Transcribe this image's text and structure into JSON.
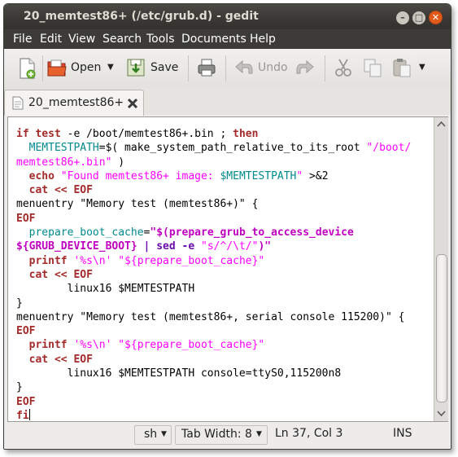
{
  "window": {
    "title": "20_memtest86+ (/etc/grub.d) - gedit",
    "buttons": {
      "minimize": "–",
      "maximize": "□",
      "close": "✕"
    }
  },
  "menu": [
    "File",
    "Edit",
    "View",
    "Search",
    "Tools",
    "Documents",
    "Help"
  ],
  "toolbar": {
    "open_label": "Open",
    "save_label": "Save",
    "undo_label": "Undo",
    "icons": [
      "new-document-icon",
      "open-folder-icon",
      "save-icon",
      "print-icon",
      "undo-icon",
      "redo-icon",
      "cut-icon",
      "copy-icon",
      "paste-icon"
    ]
  },
  "tab": {
    "label": "20_memtest86+"
  },
  "code_lines": [
    [
      [
        "kw",
        "if test"
      ],
      [
        "plain",
        " -e /boot/memtest86+.bin ; "
      ],
      [
        "kw",
        "then"
      ]
    ],
    [
      [
        "var",
        "  MEMTESTPATH"
      ],
      [
        "plain",
        "=$( make_system_path_relative_to_its_root "
      ],
      [
        "str",
        "\"/boot/"
      ]
    ],
    [
      [
        "str",
        "memtest86+.bin\""
      ],
      [
        "plain",
        " )"
      ]
    ],
    [
      [
        "kw",
        "  echo"
      ],
      [
        "str",
        " \"Found memtest86+ image: "
      ],
      [
        "var",
        "$MEMTESTPATH"
      ],
      [
        "str",
        "\""
      ],
      [
        "plain",
        " >&2"
      ]
    ],
    [
      [
        "kw",
        "  cat << EOF"
      ]
    ],
    [
      [
        "plain",
        "menuentry \"Memory test (memtest86+)\" {"
      ]
    ],
    [
      [
        "kw",
        "EOF"
      ]
    ],
    [
      [
        "var",
        "  prepare_boot_cache"
      ],
      [
        "plain",
        "="
      ],
      [
        "bstr",
        "\"$(prepare_grub_to_access_device"
      ]
    ],
    [
      [
        "bstr",
        "${GRUB_DEVICE_BOOT}"
      ],
      [
        "plain",
        " "
      ],
      [
        "cmd",
        "| sed -e"
      ],
      [
        "plain",
        " "
      ],
      [
        "str",
        "\"s/^/\\t/\""
      ],
      [
        "bstr",
        ")\""
      ]
    ],
    [
      [
        "kw",
        "  printf"
      ],
      [
        "plain",
        " "
      ],
      [
        "str",
        "'%s\\n'"
      ],
      [
        "plain",
        " "
      ],
      [
        "str",
        "\"${prepare_boot_cache}\""
      ]
    ],
    [
      [
        "kw",
        "  cat << EOF"
      ]
    ],
    [
      [
        "plain",
        "        linux16 $MEMTESTPATH"
      ]
    ],
    [
      [
        "plain",
        "}"
      ]
    ],
    [
      [
        "plain",
        "menuentry \"Memory test (memtest86+, serial console 115200)\" {"
      ]
    ],
    [
      [
        "kw",
        "EOF"
      ]
    ],
    [
      [
        "kw",
        "  printf"
      ],
      [
        "plain",
        " "
      ],
      [
        "str",
        "'%s\\n'"
      ],
      [
        "plain",
        " "
      ],
      [
        "str",
        "\"${prepare_boot_cache}\""
      ]
    ],
    [
      [
        "kw",
        "  cat << EOF"
      ]
    ],
    [
      [
        "plain",
        "        linux16 $MEMTESTPATH console=ttyS0,115200n8"
      ]
    ],
    [
      [
        "plain",
        "}"
      ]
    ],
    [
      [
        "kw",
        "EOF"
      ]
    ],
    [
      [
        "kw",
        "fi"
      ]
    ]
  ],
  "status": {
    "language": "sh",
    "tab_width": "Tab Width:  8",
    "position": "Ln 37, Col 3",
    "mode": "INS"
  },
  "colors": {
    "keyword": "#a52a2a",
    "variable": "#008a8c",
    "string": "#ff00ff",
    "titlebar": "#3c3b37",
    "close_button": "#e25a1a"
  }
}
